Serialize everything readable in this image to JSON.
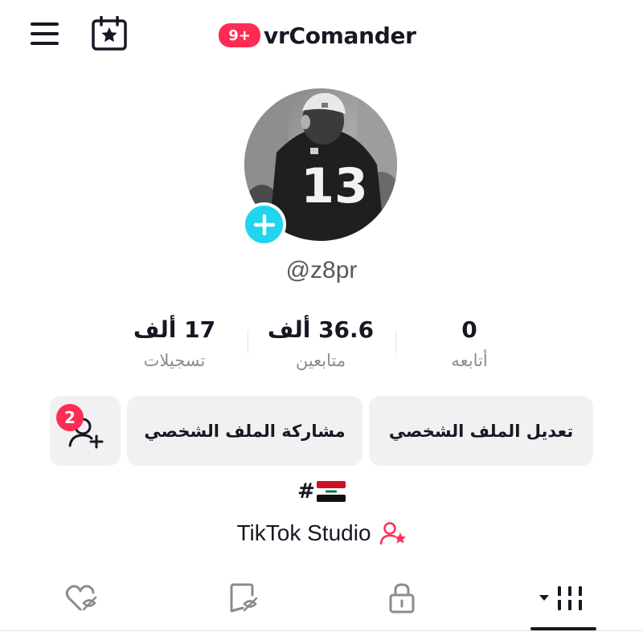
{
  "header": {
    "notification_badge": "9+",
    "title": "vrComander"
  },
  "profile": {
    "username": "@z8pr",
    "jersey_number": "13"
  },
  "stats": {
    "likes": {
      "value": "17 ألف",
      "label": "تسجيلات"
    },
    "followers": {
      "value": "36.6 ألف",
      "label": "متابعين"
    },
    "following": {
      "value": "0",
      "label": "أتابعه"
    }
  },
  "actions": {
    "edit_profile": "تعديل الملف الشخصي",
    "share_profile": "مشاركة الملف الشخصي",
    "friend_requests_badge": "2"
  },
  "bio": {
    "text": "#",
    "flag": "iraq-flag"
  },
  "studio": {
    "label": "TikTok Studio"
  },
  "tabs": [
    {
      "icon": "liked-hidden-icon"
    },
    {
      "icon": "favorites-hidden-icon"
    },
    {
      "icon": "private-lock-icon"
    },
    {
      "icon": "videos-grid-icon",
      "active": true
    }
  ],
  "colors": {
    "accent": "#fe2c55",
    "avatar_add": "#20d5ec",
    "button_bg": "#f1f1f2",
    "secondary_text": "#8a8b91"
  }
}
